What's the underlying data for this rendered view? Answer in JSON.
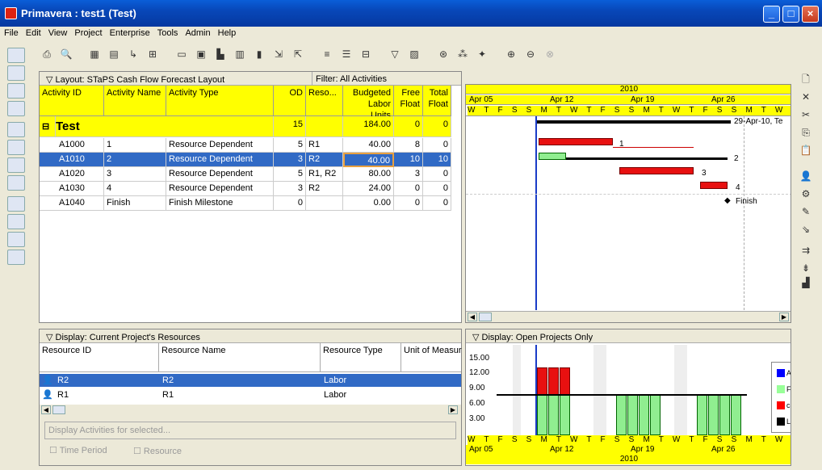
{
  "window": {
    "title": "Primavera : test1 (Test)"
  },
  "menu": [
    "File",
    "Edit",
    "View",
    "Project",
    "Enterprise",
    "Tools",
    "Admin",
    "Help"
  ],
  "activity_panel": {
    "layout_label": "Layout: STaPS Cash Flow Forecast Layout",
    "filter_label": "Filter: All Activities",
    "columns": [
      "Activity ID",
      "Activity Name",
      "Activity Type",
      "OD",
      "Reso...",
      "Budgeted Labor Units",
      "Free Float",
      "Total Float"
    ],
    "group": {
      "name": "Test",
      "od": "15",
      "units": "184.00",
      "free": "0",
      "total": "0"
    },
    "rows": [
      {
        "id": "A1000",
        "name": "1",
        "type": "Resource Dependent",
        "od": "5",
        "res": "R1",
        "units": "40.00",
        "free": "8",
        "total": "0"
      },
      {
        "id": "A1010",
        "name": "2",
        "type": "Resource Dependent",
        "od": "3",
        "res": "R2",
        "units": "40.00",
        "free": "10",
        "total": "10"
      },
      {
        "id": "A1020",
        "name": "3",
        "type": "Resource Dependent",
        "od": "5",
        "res": "R1, R2",
        "units": "80.00",
        "free": "3",
        "total": "0"
      },
      {
        "id": "A1030",
        "name": "4",
        "type": "Resource Dependent",
        "od": "3",
        "res": "R2",
        "units": "24.00",
        "free": "0",
        "total": "0"
      },
      {
        "id": "A1040",
        "name": "Finish",
        "type": "Finish Milestone",
        "od": "0",
        "res": "",
        "units": "0.00",
        "free": "0",
        "total": "0"
      }
    ]
  },
  "gantt": {
    "year": "2010",
    "weeks": [
      "Apr 05",
      "Apr 12",
      "Apr 19",
      "Apr 26"
    ],
    "days": "W T F S S M T W T F S S M T W T F S S M T W T F S S M T W T F S S M T",
    "labels": {
      "b1": "1",
      "b2": "2",
      "b3": "3",
      "b4": "4",
      "finish": "Finish",
      "summary_end": "29-Apr-10, Te"
    }
  },
  "resource_panel": {
    "display_label": "Display: Current Project's Resources",
    "columns": [
      "Resource ID",
      "Resource Name",
      "Resource Type",
      "Unit of Measur"
    ],
    "rows": [
      {
        "id": "R2",
        "name": "R2",
        "type": "Labor"
      },
      {
        "id": "R1",
        "name": "R1",
        "type": "Labor"
      }
    ],
    "display_activities": "Display Activities for selected...",
    "time_period": "Time Period",
    "resource": "Resource"
  },
  "histogram": {
    "display_label": "Display: Open Projects Only",
    "yticks": [
      "15.00",
      "12.00",
      "9.00",
      "6.00",
      "3.00"
    ],
    "legend_colors": [
      "#0000ff",
      "#99ff99",
      "#ff0000",
      "#000000"
    ],
    "legend_letters": [
      "A",
      "F",
      "c",
      "L"
    ]
  }
}
